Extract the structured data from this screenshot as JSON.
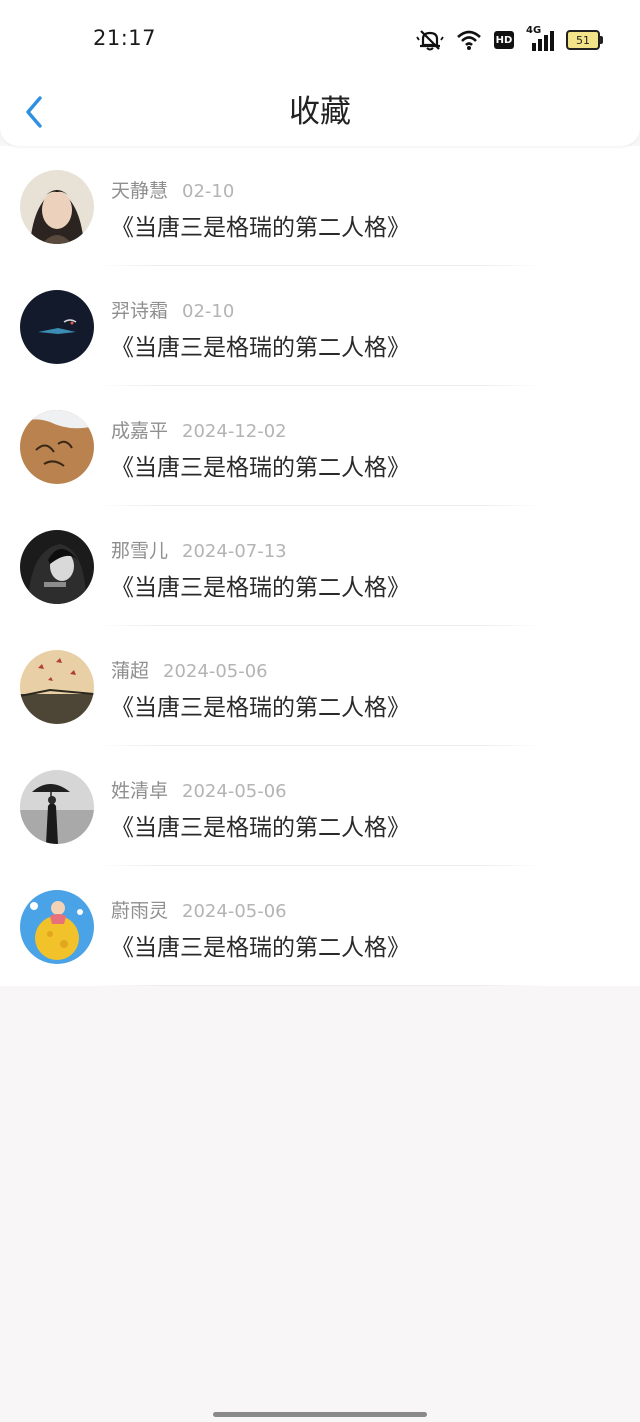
{
  "status_bar": {
    "time": "21:17",
    "icons": [
      "bell-off-icon",
      "wifi-icon",
      "hd-icon",
      "cellular-4g-icon",
      "battery-icon"
    ],
    "hd_label": "HD",
    "network_label": "4G",
    "battery_level": "51"
  },
  "nav": {
    "back_icon": "chevron-left-icon",
    "back_color": "#2f8fe0",
    "title": "收藏"
  },
  "favorites": [
    {
      "name": "天静慧",
      "date": "02-10",
      "title": "《当唐三是格瑞的第二人格》",
      "avatar": "avatar-portrait"
    },
    {
      "name": "羿诗霜",
      "date": "02-10",
      "title": "《当唐三是格瑞的第二人格》",
      "avatar": "avatar-dark-fish"
    },
    {
      "name": "成嘉平",
      "date": "2024-12-02",
      "title": "《当唐三是格瑞的第二人格》",
      "avatar": "avatar-sand-beach"
    },
    {
      "name": "那雪儿",
      "date": "2024-07-13",
      "title": "《当唐三是格瑞的第二人格》",
      "avatar": "avatar-bw-girl"
    },
    {
      "name": "蒲超",
      "date": "2024-05-06",
      "title": "《当唐三是格瑞的第二人格》",
      "avatar": "avatar-butterflies"
    },
    {
      "name": "姓清卓",
      "date": "2024-05-06",
      "title": "《当唐三是格瑞的第二人格》",
      "avatar": "avatar-umbrella-street"
    },
    {
      "name": "蔚雨灵",
      "date": "2024-05-06",
      "title": "《当唐三是格瑞的第二人格》",
      "avatar": "avatar-cartoon-moon"
    }
  ]
}
